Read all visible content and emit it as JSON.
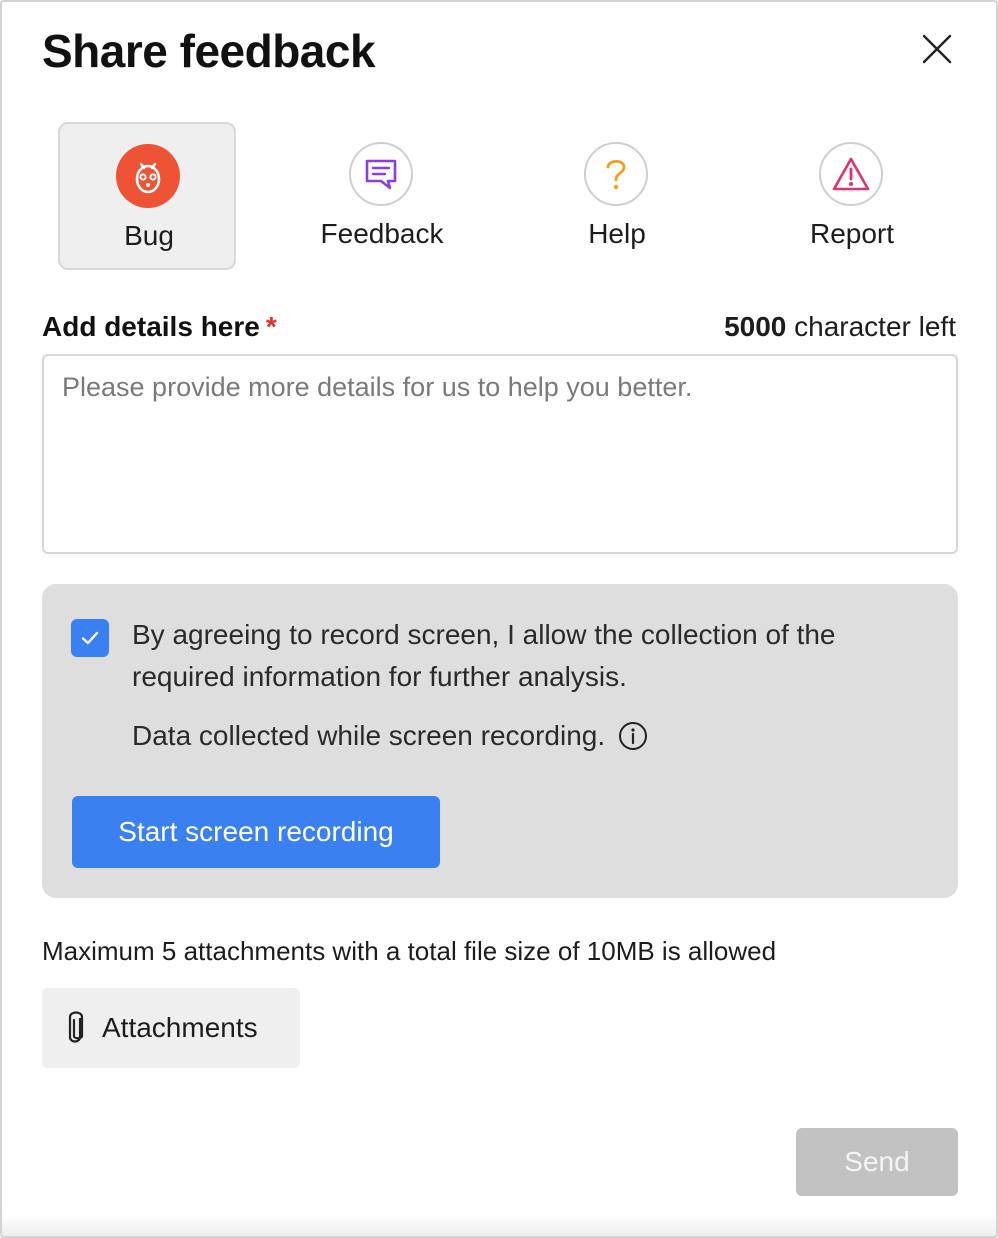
{
  "dialog": {
    "title": "Share feedback",
    "close_icon": "close-icon"
  },
  "types": [
    {
      "label": "Bug",
      "icon": "bug-icon",
      "selected": true,
      "color": "#ee5335"
    },
    {
      "label": "Feedback",
      "icon": "chat-icon",
      "selected": false,
      "color": "#8b3fe0"
    },
    {
      "label": "Help",
      "icon": "question-icon",
      "selected": false,
      "color": "#f0a020"
    },
    {
      "label": "Report",
      "icon": "warning-icon",
      "selected": false,
      "color": "#e0336a"
    }
  ],
  "details": {
    "label": "Add details here",
    "required_mark": "*",
    "char_count": "5000",
    "char_suffix": "character left",
    "placeholder": "Please provide more details for us to help you better.",
    "value": ""
  },
  "recording": {
    "checkbox_checked": true,
    "consent_text": "By agreeing to record screen, I allow the collection of the required information for further analysis.",
    "data_collected_text": "Data collected while screen recording.",
    "start_button": "Start screen recording",
    "accent": "#3a80f0"
  },
  "attachments": {
    "note": "Maximum 5 attachments with a total file size of 10MB is allowed",
    "button": "Attachments",
    "icon": "paperclip-icon"
  },
  "footer": {
    "send_button": "Send",
    "send_enabled": false
  }
}
